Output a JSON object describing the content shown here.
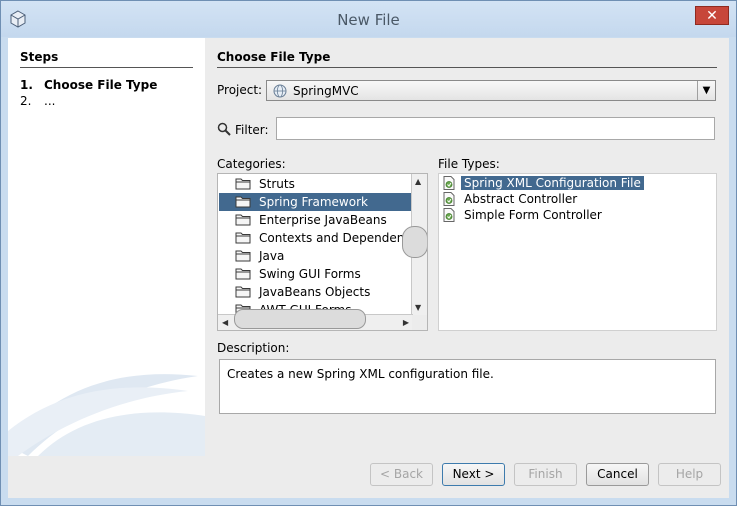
{
  "window": {
    "title": "New File",
    "close_glyph": "✕"
  },
  "steps": {
    "title": "Steps",
    "items": [
      {
        "num": "1.",
        "label": "Choose File Type"
      },
      {
        "num": "2.",
        "label": "..."
      }
    ]
  },
  "main": {
    "title": "Choose File Type",
    "project_label": "Project:",
    "project_value": "SpringMVC",
    "filter_label": "Filter:",
    "filter_value": "",
    "categories_label": "Categories:",
    "categories": [
      "Struts",
      "Spring Framework",
      "Enterprise JavaBeans",
      "Contexts and Dependency In",
      "Java",
      "Swing GUI Forms",
      "JavaBeans Objects",
      "AWT GUI Forms"
    ],
    "selected_category": "Spring Framework",
    "file_types_label": "File Types:",
    "file_types": [
      "Spring XML Configuration File",
      "Abstract Controller",
      "Simple Form Controller"
    ],
    "selected_file_type": "Spring XML Configuration File",
    "description_label": "Description:",
    "description": "Creates a new Spring XML configuration file."
  },
  "buttons": {
    "back": "< Back",
    "next": "Next >",
    "finish": "Finish",
    "cancel": "Cancel",
    "help": "Help"
  },
  "icons": {
    "app": "cube-icon",
    "project": "globe-icon",
    "filter": "magnifier-icon",
    "category": "folder-icon",
    "file_type": "spring-file-icon"
  },
  "colors": {
    "selection": "#42698f",
    "close_button": "#c7463a",
    "titlebar": "#c9dcef"
  }
}
